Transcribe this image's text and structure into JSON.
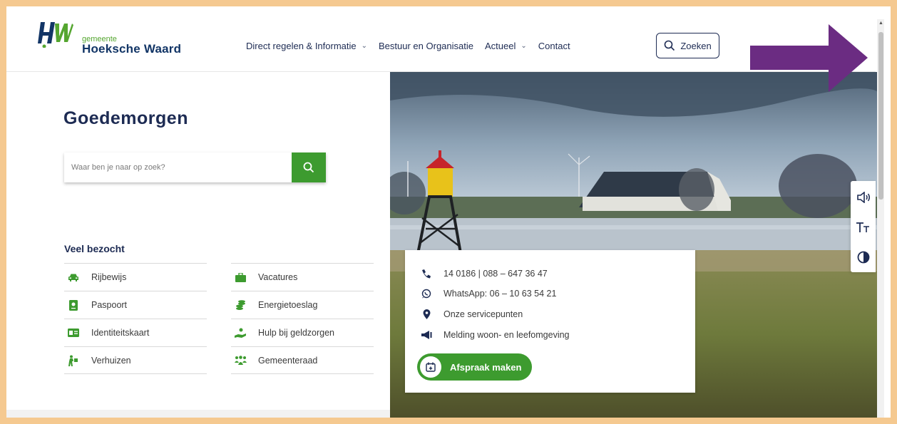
{
  "header": {
    "logo_small": "gemeente",
    "logo_big": "Hoeksche Waard",
    "nav": [
      {
        "label": "Direct regelen & Informatie",
        "dropdown": true
      },
      {
        "label": "Bestuur en Organisatie",
        "dropdown": false
      },
      {
        "label": "Actueel",
        "dropdown": true
      },
      {
        "label": "Contact",
        "dropdown": false
      }
    ],
    "search_label": "Zoeken"
  },
  "main": {
    "greeting": "Goedemorgen",
    "search_placeholder": "Waar ben je naar op zoek?",
    "veel_bezocht_title": "Veel bezocht",
    "col1": [
      {
        "label": "Rijbewijs",
        "icon": "car-icon"
      },
      {
        "label": "Paspoort",
        "icon": "passport-icon"
      },
      {
        "label": "Identiteitskaart",
        "icon": "id-card-icon"
      },
      {
        "label": "Verhuizen",
        "icon": "moving-person-icon"
      }
    ],
    "col2": [
      {
        "label": "Vacatures",
        "icon": "briefcase-icon"
      },
      {
        "label": "Energietoeslag",
        "icon": "coins-icon"
      },
      {
        "label": "Hulp bij geldzorgen",
        "icon": "hand-money-icon"
      },
      {
        "label": "Gemeenteraad",
        "icon": "people-group-icon"
      }
    ]
  },
  "contact": {
    "phone": "14 0186 | 088 – 647 36 47",
    "whatsapp": "WhatsApp: 06 – 10 63 54 21",
    "servicepunten": "Onze servicepunten",
    "melding": "Melding woon- en leefomgeving",
    "afspraak": "Afspraak maken"
  },
  "accessibility": [
    "speaker-icon",
    "text-size-icon",
    "contrast-icon"
  ],
  "colors": {
    "brand_green": "#3d9b2f",
    "brand_navy": "#1d2b53",
    "frame": "#f5c990",
    "arrow": "#6b2c82"
  }
}
